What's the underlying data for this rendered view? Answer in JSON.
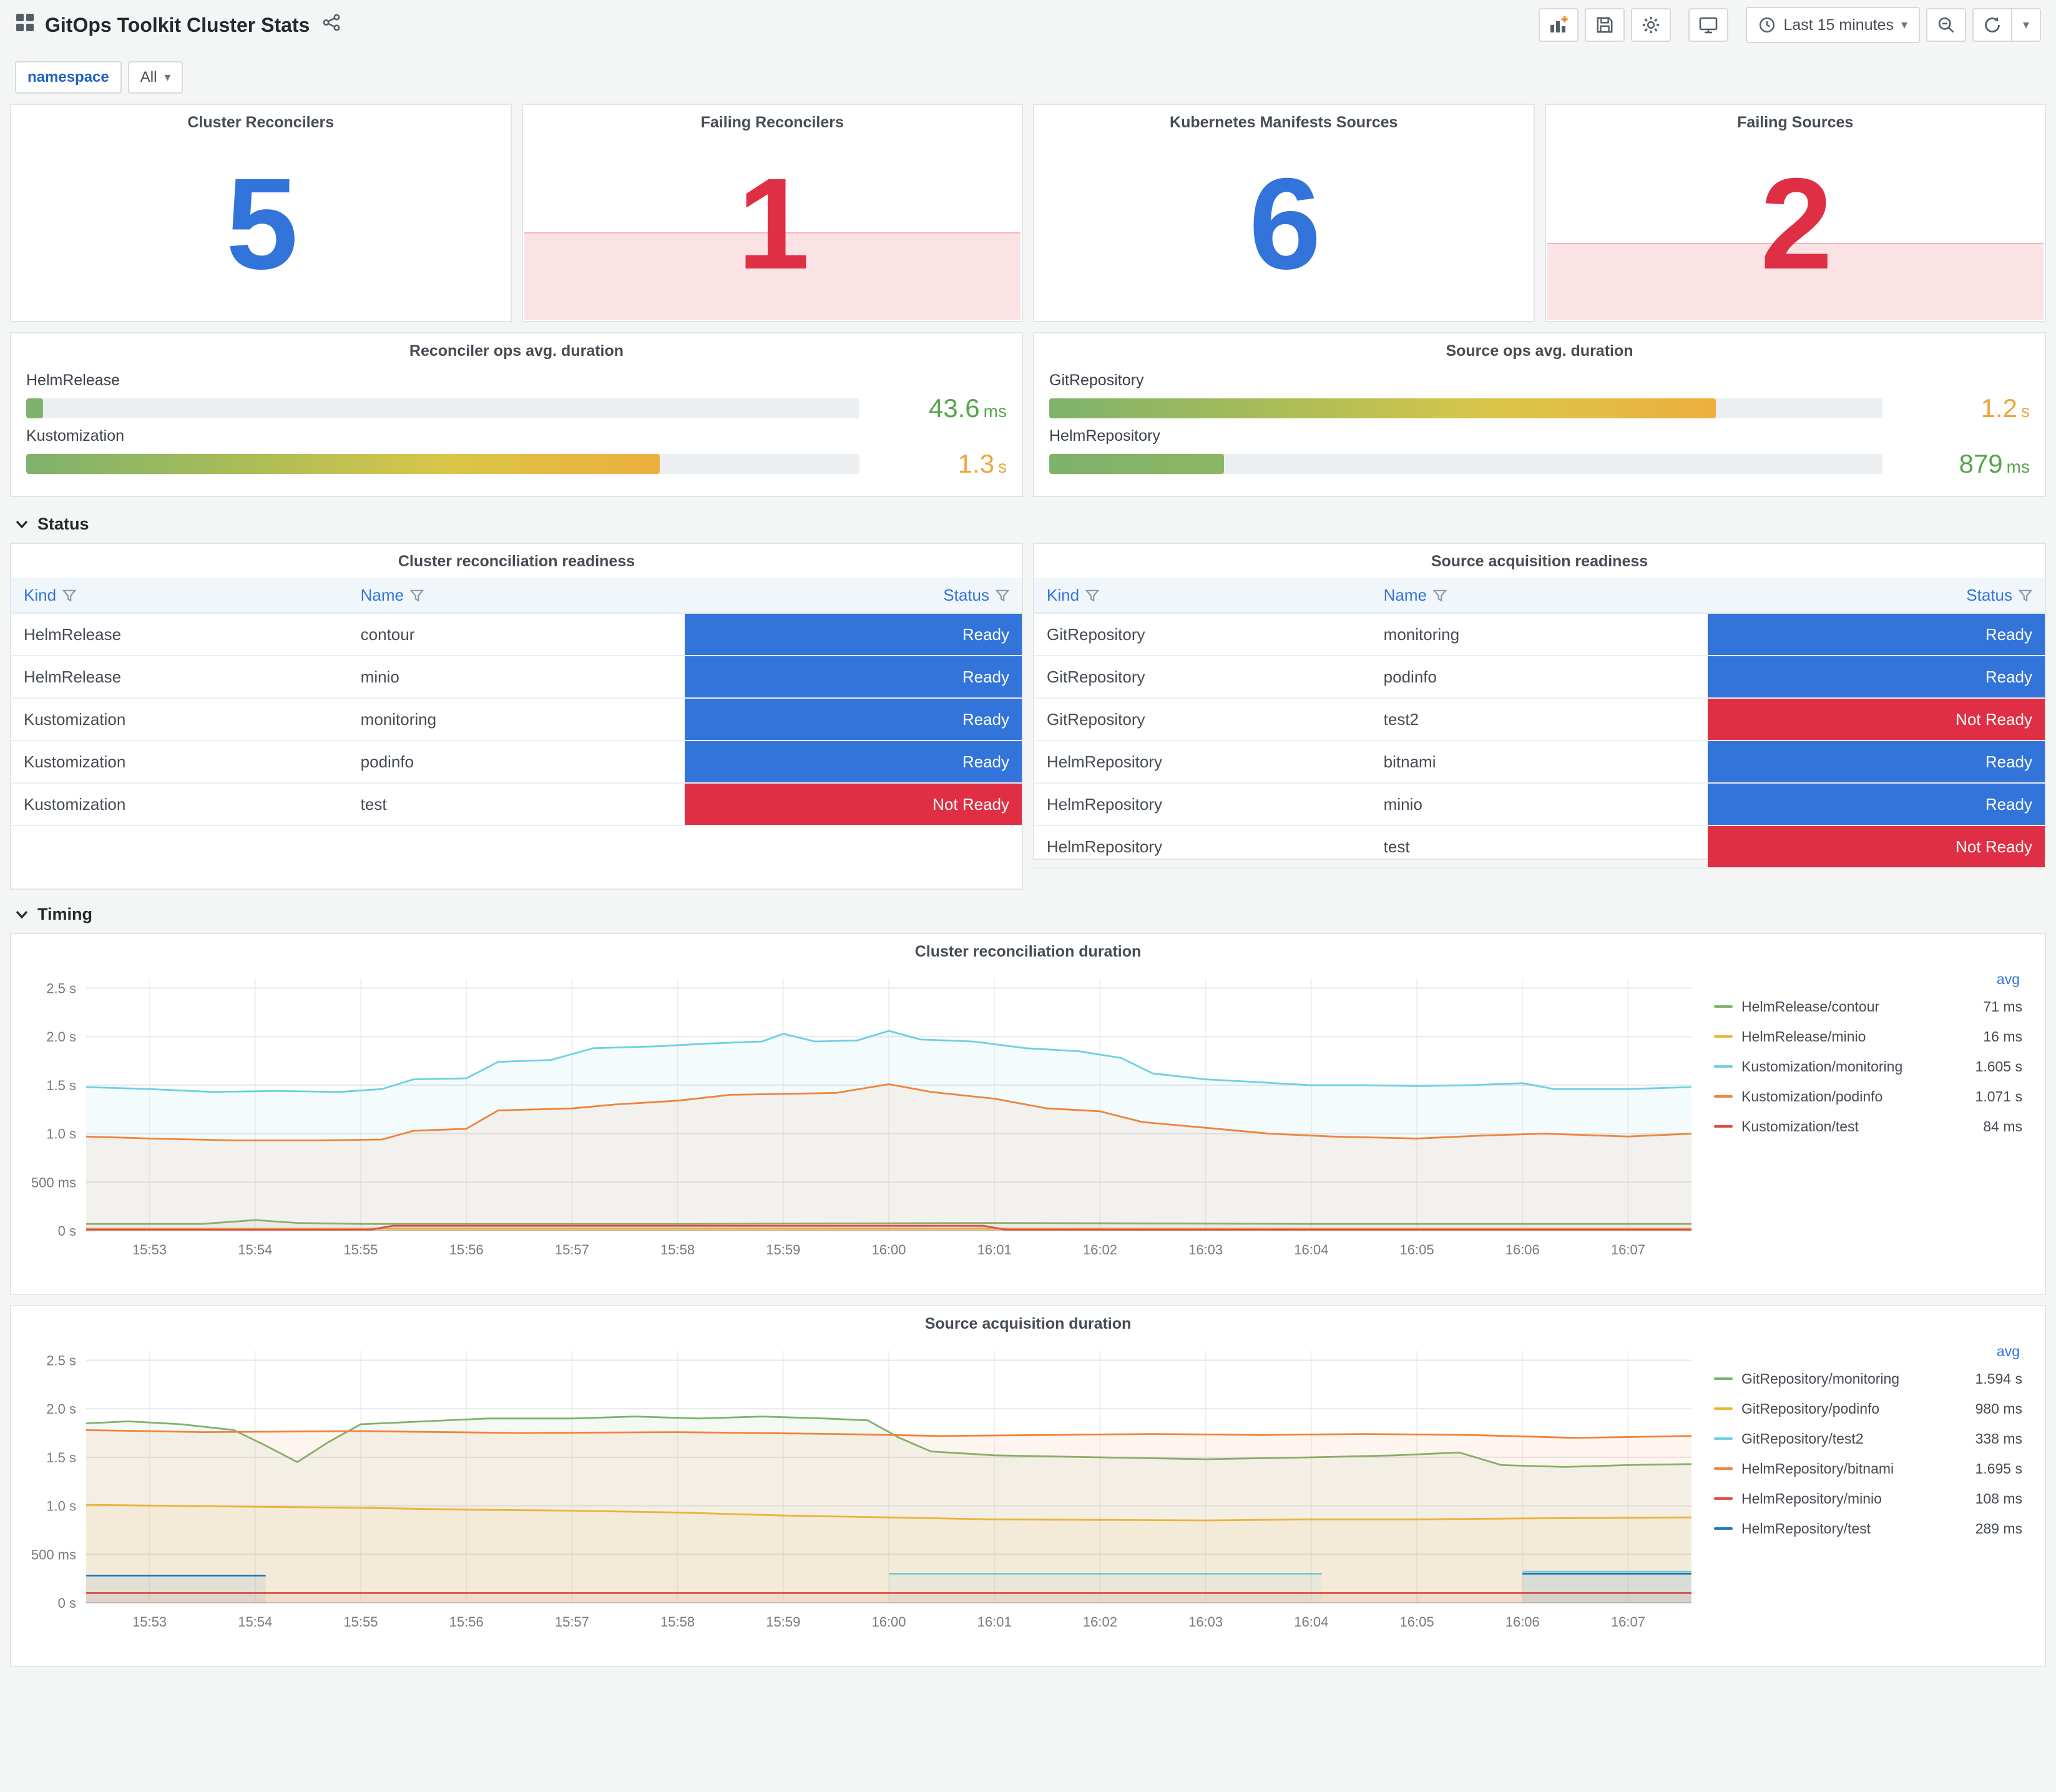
{
  "header": {
    "title": "GitOps Toolkit Cluster Stats"
  },
  "toolbar": {
    "time_range": "Last 15 minutes"
  },
  "icons": {
    "caret": "▾"
  },
  "variables": {
    "label": "namespace",
    "value": "All"
  },
  "sections": {
    "status": "Status",
    "timing": "Timing"
  },
  "status_colors": {
    "Ready": "#3274D9",
    "Not Ready": "#E02F44"
  },
  "stat_panels": [
    {
      "title": "Cluster Reconcilers",
      "value": "5",
      "color": "#3274D9",
      "band": 0
    },
    {
      "title": "Failing Reconcilers",
      "value": "1",
      "color": "#DE2F44",
      "band": 0.4
    },
    {
      "title": "Kubernetes Manifests Sources",
      "value": "6",
      "color": "#3274D9",
      "band": 0
    },
    {
      "title": "Failing Sources",
      "value": "2",
      "color": "#DE2F44",
      "band": 0.35
    }
  ],
  "gauge_panels": [
    {
      "title": "Reconciler ops avg. duration",
      "rows": [
        {
          "label": "HelmRelease",
          "value": "43.6",
          "unit": "ms",
          "percent": 2,
          "value_color": "#56A64B",
          "bar_colors": [
            "#7EB26D",
            "#7EB26D"
          ]
        },
        {
          "label": "Kustomization",
          "value": "1.3",
          "unit": "s",
          "percent": 76,
          "value_color": "#EFA53D",
          "bar_colors": [
            "#7EB26D",
            "#A9BC58",
            "#D9C64A",
            "#EDAF3E"
          ]
        }
      ]
    },
    {
      "title": "Source ops avg. duration",
      "rows": [
        {
          "label": "GitRepository",
          "value": "1.2",
          "unit": "s",
          "percent": 80,
          "value_color": "#EFA53D",
          "bar_colors": [
            "#7EB26D",
            "#A9BC58",
            "#D9C64A",
            "#EDAF3E"
          ]
        },
        {
          "label": "HelmRepository",
          "value": "879",
          "unit": "ms",
          "percent": 21,
          "value_color": "#56A64B",
          "bar_colors": [
            "#7EB26D",
            "#8DB663"
          ]
        }
      ]
    }
  ],
  "tables": [
    {
      "title": "Cluster reconciliation readiness",
      "columns": [
        "Kind",
        "Name",
        "Status"
      ],
      "rows": [
        {
          "kind": "HelmRelease",
          "name": "contour",
          "status": "Ready"
        },
        {
          "kind": "HelmRelease",
          "name": "minio",
          "status": "Ready"
        },
        {
          "kind": "Kustomization",
          "name": "monitoring",
          "status": "Ready"
        },
        {
          "kind": "Kustomization",
          "name": "podinfo",
          "status": "Ready"
        },
        {
          "kind": "Kustomization",
          "name": "test",
          "status": "Not Ready"
        }
      ]
    },
    {
      "title": "Source acquisition readiness",
      "columns": [
        "Kind",
        "Name",
        "Status"
      ],
      "rows": [
        {
          "kind": "GitRepository",
          "name": "monitoring",
          "status": "Ready"
        },
        {
          "kind": "GitRepository",
          "name": "podinfo",
          "status": "Ready"
        },
        {
          "kind": "GitRepository",
          "name": "test2",
          "status": "Not Ready"
        },
        {
          "kind": "HelmRepository",
          "name": "bitnami",
          "status": "Ready"
        },
        {
          "kind": "HelmRepository",
          "name": "minio",
          "status": "Ready"
        },
        {
          "kind": "HelmRepository",
          "name": "test",
          "status": "Not Ready"
        }
      ]
    }
  ],
  "chart_data": [
    {
      "type": "line",
      "title": "Cluster reconciliation duration",
      "legend_header": "avg",
      "legend_position": "right",
      "grid": true,
      "ylim": [
        0,
        2.6
      ],
      "y_ticks": [
        {
          "v": 0,
          "label": "0 s"
        },
        {
          "v": 0.5,
          "label": "500 ms"
        },
        {
          "v": 1.0,
          "label": "1.0 s"
        },
        {
          "v": 1.5,
          "label": "1.5 s"
        },
        {
          "v": 2.0,
          "label": "2.0 s"
        },
        {
          "v": 2.5,
          "label": "2.5 s"
        }
      ],
      "x_ticks": [
        "15:53",
        "15:54",
        "15:55",
        "15:56",
        "15:57",
        "15:58",
        "15:59",
        "16:00",
        "16:01",
        "16:02",
        "16:03",
        "16:04",
        "16:05",
        "16:06",
        "16:07"
      ],
      "series": [
        {
          "name": "HelmRelease/contour",
          "avg": "71 ms",
          "color": "#7EB26D",
          "points": [
            [
              0.4,
              0.07
            ],
            [
              1.5,
              0.07
            ],
            [
              2.0,
              0.11
            ],
            [
              2.4,
              0.08
            ],
            [
              3.0,
              0.07
            ],
            [
              6.0,
              0.07
            ],
            [
              9.0,
              0.08
            ],
            [
              12.0,
              0.07
            ],
            [
              15.6,
              0.07
            ]
          ]
        },
        {
          "name": "HelmRelease/minio",
          "avg": "16 ms",
          "color": "#EAB839",
          "points": [
            [
              0.4,
              0.02
            ],
            [
              15.6,
              0.02
            ]
          ]
        },
        {
          "name": "Kustomization/monitoring",
          "avg": "1.605 s",
          "color": "#6ED0E0",
          "points": [
            [
              0.4,
              1.48
            ],
            [
              1.0,
              1.46
            ],
            [
              1.6,
              1.43
            ],
            [
              2.2,
              1.44
            ],
            [
              2.8,
              1.43
            ],
            [
              3.2,
              1.46
            ],
            [
              3.5,
              1.56
            ],
            [
              4.0,
              1.57
            ],
            [
              4.3,
              1.74
            ],
            [
              4.8,
              1.76
            ],
            [
              5.2,
              1.88
            ],
            [
              5.8,
              1.9
            ],
            [
              6.3,
              1.93
            ],
            [
              6.8,
              1.95
            ],
            [
              7.0,
              2.03
            ],
            [
              7.3,
              1.95
            ],
            [
              7.7,
              1.96
            ],
            [
              8.0,
              2.06
            ],
            [
              8.3,
              1.97
            ],
            [
              8.8,
              1.95
            ],
            [
              9.3,
              1.88
            ],
            [
              9.8,
              1.85
            ],
            [
              10.2,
              1.78
            ],
            [
              10.5,
              1.62
            ],
            [
              11.0,
              1.56
            ],
            [
              11.5,
              1.53
            ],
            [
              12.0,
              1.5
            ],
            [
              12.5,
              1.5
            ],
            [
              13.0,
              1.49
            ],
            [
              13.5,
              1.5
            ],
            [
              14.0,
              1.52
            ],
            [
              14.3,
              1.46
            ],
            [
              15.0,
              1.46
            ],
            [
              15.6,
              1.48
            ]
          ]
        },
        {
          "name": "Kustomization/podinfo",
          "avg": "1.071 s",
          "color": "#EF843C",
          "points": [
            [
              0.4,
              0.97
            ],
            [
              1.0,
              0.95
            ],
            [
              1.8,
              0.93
            ],
            [
              2.6,
              0.93
            ],
            [
              3.2,
              0.94
            ],
            [
              3.5,
              1.03
            ],
            [
              4.0,
              1.05
            ],
            [
              4.3,
              1.24
            ],
            [
              5.0,
              1.26
            ],
            [
              5.4,
              1.3
            ],
            [
              6.0,
              1.34
            ],
            [
              6.5,
              1.4
            ],
            [
              7.0,
              1.41
            ],
            [
              7.5,
              1.42
            ],
            [
              8.0,
              1.51
            ],
            [
              8.4,
              1.43
            ],
            [
              9.0,
              1.36
            ],
            [
              9.5,
              1.26
            ],
            [
              10.0,
              1.23
            ],
            [
              10.4,
              1.12
            ],
            [
              11.0,
              1.06
            ],
            [
              11.6,
              1.0
            ],
            [
              12.2,
              0.97
            ],
            [
              13.0,
              0.95
            ],
            [
              13.6,
              0.98
            ],
            [
              14.2,
              1.0
            ],
            [
              15.0,
              0.97
            ],
            [
              15.6,
              1.0
            ]
          ]
        },
        {
          "name": "Kustomization/test",
          "avg": "84 ms",
          "color": "#E24D42",
          "points": [
            [
              0.4,
              0.012
            ],
            [
              3.1,
              0.012
            ],
            [
              3.3,
              0.05
            ],
            [
              8.9,
              0.05
            ],
            [
              9.1,
              0.012
            ],
            [
              15.6,
              0.012
            ]
          ]
        }
      ]
    },
    {
      "type": "line",
      "title": "Source acquisition duration",
      "legend_header": "avg",
      "legend_position": "right",
      "grid": true,
      "ylim": [
        0,
        2.6
      ],
      "y_ticks": [
        {
          "v": 0,
          "label": "0 s"
        },
        {
          "v": 0.5,
          "label": "500 ms"
        },
        {
          "v": 1.0,
          "label": "1.0 s"
        },
        {
          "v": 1.5,
          "label": "1.5 s"
        },
        {
          "v": 2.0,
          "label": "2.0 s"
        },
        {
          "v": 2.5,
          "label": "2.5 s"
        }
      ],
      "x_ticks": [
        "15:53",
        "15:54",
        "15:55",
        "15:56",
        "15:57",
        "15:58",
        "15:59",
        "16:00",
        "16:01",
        "16:02",
        "16:03",
        "16:04",
        "16:05",
        "16:06",
        "16:07"
      ],
      "series": [
        {
          "name": "GitRepository/monitoring",
          "avg": "1.594 s",
          "color": "#7EB26D",
          "points": [
            [
              0.4,
              1.85
            ],
            [
              0.8,
              1.87
            ],
            [
              1.3,
              1.84
            ],
            [
              1.8,
              1.78
            ],
            [
              2.1,
              1.62
            ],
            [
              2.4,
              1.45
            ],
            [
              2.7,
              1.66
            ],
            [
              3.0,
              1.84
            ],
            [
              3.6,
              1.87
            ],
            [
              4.2,
              1.9
            ],
            [
              5.0,
              1.9
            ],
            [
              5.6,
              1.92
            ],
            [
              6.2,
              1.9
            ],
            [
              6.8,
              1.92
            ],
            [
              7.4,
              1.9
            ],
            [
              7.8,
              1.88
            ],
            [
              8.1,
              1.7
            ],
            [
              8.4,
              1.56
            ],
            [
              9.0,
              1.52
            ],
            [
              10.0,
              1.5
            ],
            [
              11.0,
              1.48
            ],
            [
              12.0,
              1.5
            ],
            [
              12.8,
              1.52
            ],
            [
              13.4,
              1.55
            ],
            [
              13.8,
              1.42
            ],
            [
              14.4,
              1.4
            ],
            [
              15.0,
              1.42
            ],
            [
              15.6,
              1.43
            ]
          ]
        },
        {
          "name": "GitRepository/podinfo",
          "avg": "980 ms",
          "color": "#EAB839",
          "points": [
            [
              0.4,
              1.01
            ],
            [
              1.2,
              1.0
            ],
            [
              2.0,
              0.99
            ],
            [
              3.0,
              0.98
            ],
            [
              4.0,
              0.96
            ],
            [
              5.0,
              0.95
            ],
            [
              6.0,
              0.93
            ],
            [
              7.0,
              0.9
            ],
            [
              8.0,
              0.88
            ],
            [
              9.0,
              0.86
            ],
            [
              10.0,
              0.855
            ],
            [
              11.0,
              0.85
            ],
            [
              12.0,
              0.86
            ],
            [
              13.0,
              0.86
            ],
            [
              14.0,
              0.87
            ],
            [
              15.6,
              0.88
            ]
          ]
        },
        {
          "name": "GitRepository/test2",
          "avg": "338 ms",
          "color": "#6ED0E0",
          "points": [
            [
              8.0,
              0.3
            ],
            [
              12.1,
              0.3
            ],
            null,
            [
              14.0,
              0.32
            ],
            [
              15.6,
              0.32
            ]
          ]
        },
        {
          "name": "HelmRepository/bitnami",
          "avg": "1.695 s",
          "color": "#EF843C",
          "points": [
            [
              0.4,
              1.78
            ],
            [
              1.5,
              1.76
            ],
            [
              3.0,
              1.77
            ],
            [
              4.5,
              1.75
            ],
            [
              6.0,
              1.76
            ],
            [
              7.5,
              1.74
            ],
            [
              8.5,
              1.72
            ],
            [
              9.5,
              1.73
            ],
            [
              10.5,
              1.74
            ],
            [
              11.5,
              1.73
            ],
            [
              12.5,
              1.74
            ],
            [
              13.5,
              1.73
            ],
            [
              14.5,
              1.7
            ],
            [
              15.6,
              1.72
            ]
          ]
        },
        {
          "name": "HelmRepository/minio",
          "avg": "108 ms",
          "color": "#E24D42",
          "points": [
            [
              0.4,
              0.1
            ],
            [
              15.6,
              0.1
            ]
          ]
        },
        {
          "name": "HelmRepository/test",
          "avg": "289 ms",
          "color": "#1F78C1",
          "points": [
            [
              0.4,
              0.28
            ],
            [
              2.1,
              0.28
            ],
            null,
            [
              14.0,
              0.3
            ],
            [
              15.6,
              0.3
            ]
          ]
        }
      ]
    }
  ]
}
